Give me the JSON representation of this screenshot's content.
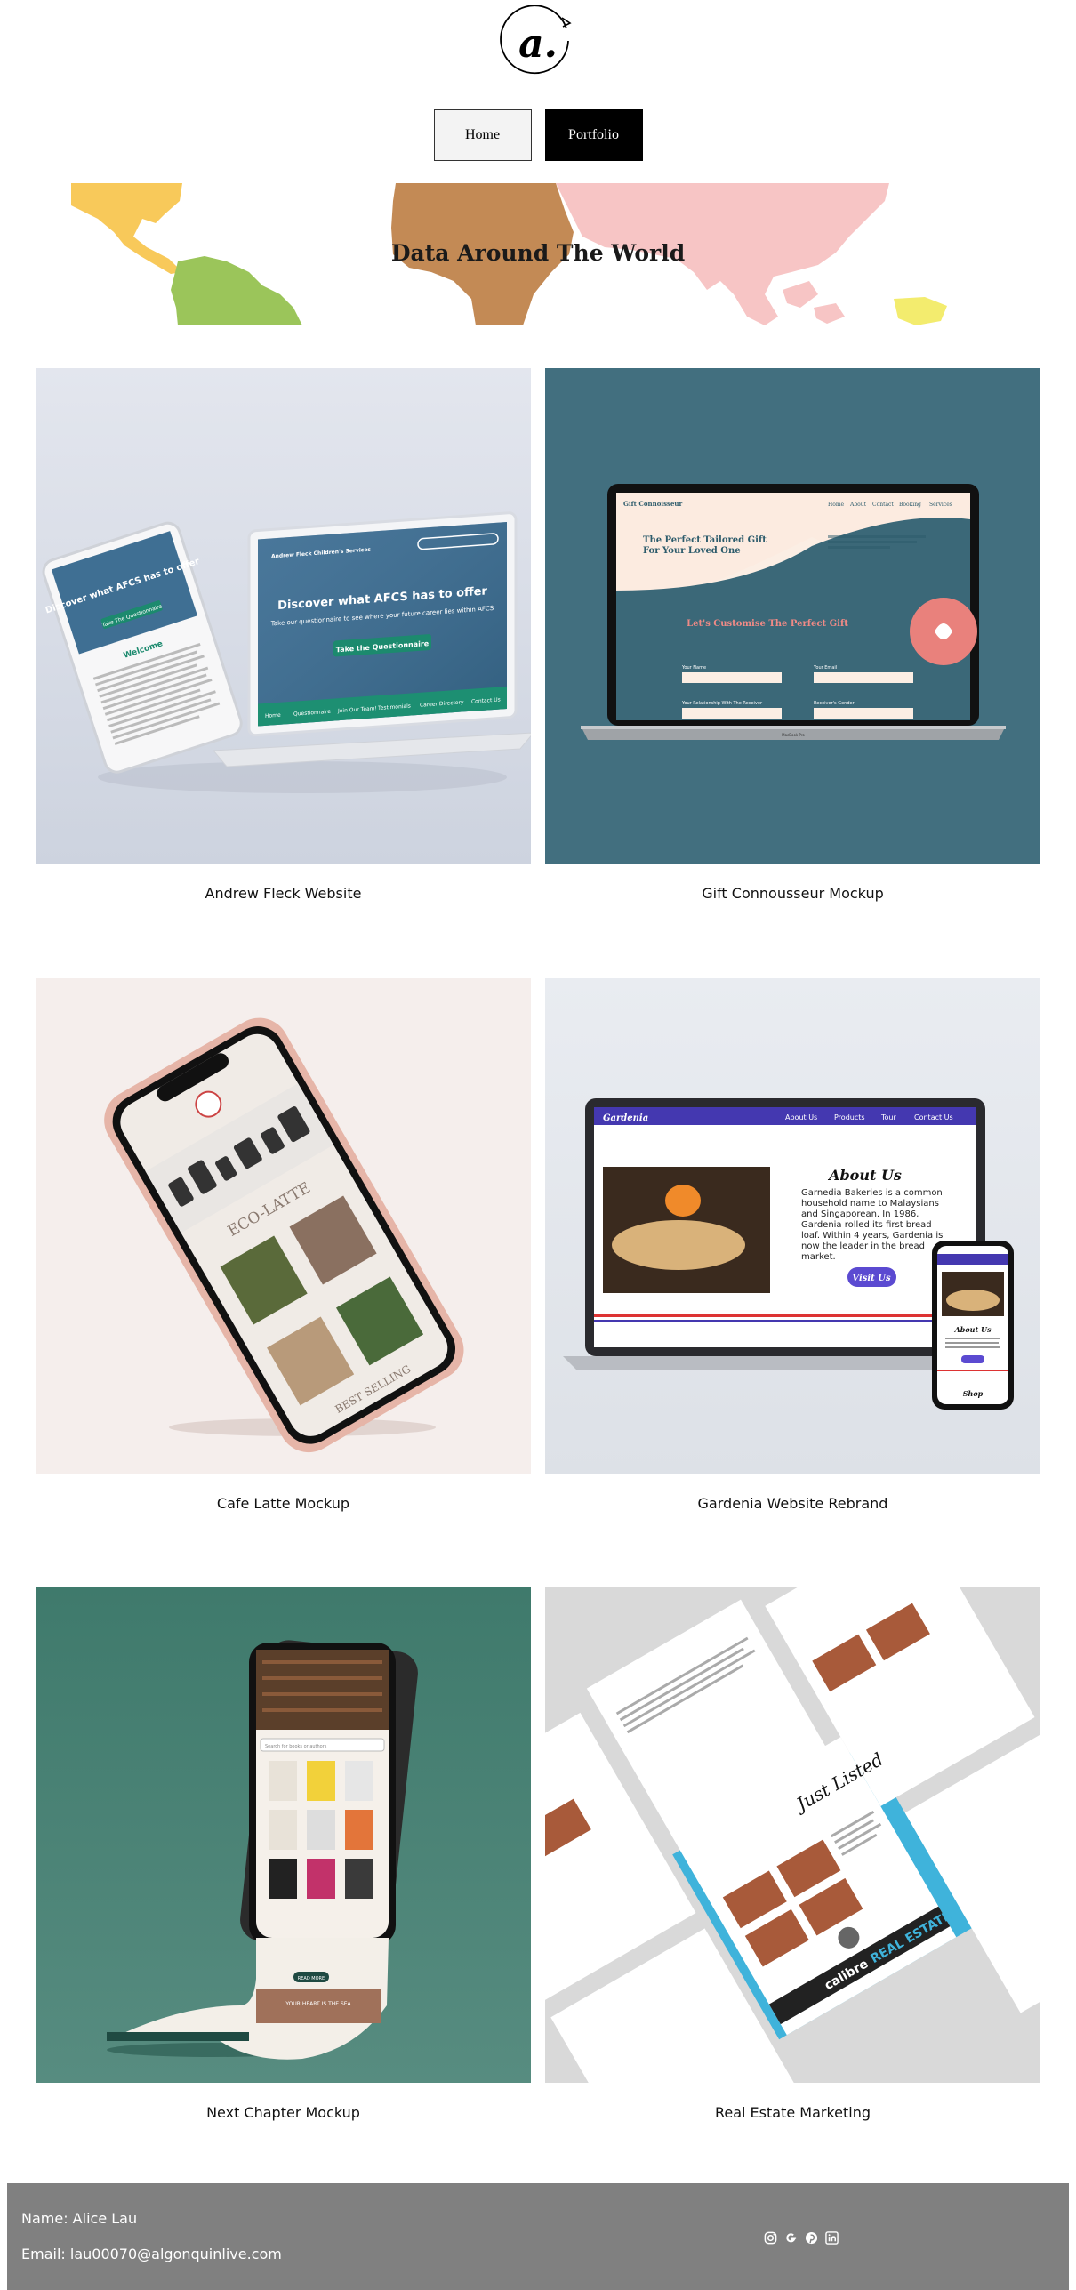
{
  "logo": {
    "letter": "a."
  },
  "nav": {
    "items": [
      {
        "label": "Home"
      },
      {
        "label": "Portfolio"
      }
    ]
  },
  "banner": {
    "title": "Data Around The World"
  },
  "projects": [
    {
      "title": "Andrew Fleck Website",
      "mock": {
        "heading": "Discover what AFCS has to offer",
        "sub": "Take our questionnaire to see where your future career lies within AFCS",
        "cta": "Take the Questionnaire",
        "brand": "Andrew Fleck Children's Services",
        "tablet_heading": "Discover what AFCS has to offer",
        "tablet_cta": "Take The Questionnaire",
        "tablet_welcome": "Welcome",
        "nav": [
          "Home",
          "Questionnaire",
          "Join Our Team!",
          "Testimonials",
          "Career Directory",
          "Contact Us"
        ]
      }
    },
    {
      "title": "Gift Connousseur Mockup",
      "mock": {
        "brand": "Gift Connoisseur",
        "nav": [
          "Home",
          "About",
          "Contact",
          "Booking",
          "Services"
        ],
        "headline": "The Perfect Tailored Gift For Your Loved One",
        "section": "Let's Customise The Perfect Gift",
        "fields": [
          "Your Name",
          "Your Email",
          "Your Relationship With The Receiver",
          "Receiver's Gender"
        ],
        "laptop_label": "MacBook Pro"
      }
    },
    {
      "title": "Cafe Latte Mockup",
      "mock": {
        "brand": "ECO-LATTE",
        "footer": "BEST SELLING"
      }
    },
    {
      "title": "Gardenia Website Rebrand",
      "mock": {
        "brand": "Gardenia",
        "nav": [
          "About Us",
          "Products",
          "Tour",
          "Contact Us"
        ],
        "heading": "About Us",
        "body": "Garnedia Bakeries is a common household name to Malaysians and Singaporean. In 1986, Gardenia rolled its first bread loaf. Within 4 years, Gardenia is now the leader in the bread market.",
        "cta": "Visit Us",
        "phone_heading": "About Us",
        "phone_shop": "Shop"
      }
    },
    {
      "title": "Next Chapter Mockup",
      "mock": {
        "search": "Search for books or authors",
        "cta": "READ MORE",
        "tagline": "YOUR HEART IS THE SEA"
      }
    },
    {
      "title": "Real Estate Marketing",
      "mock": {
        "script": "Just Listed",
        "brand_a": "calibre",
        "brand_b": "REAL ESTATE"
      }
    }
  ],
  "footer": {
    "name": "Name: Alice Lau",
    "email": "Email: lau00070@algonquinlive.com",
    "socials": [
      {
        "icon": "instagram-icon"
      },
      {
        "icon": "google-icon"
      },
      {
        "icon": "pinterest-icon"
      },
      {
        "icon": "linkedin-icon"
      }
    ]
  },
  "colors": {
    "teal": "#426f7f",
    "green": "#3a7466",
    "pink": "#f5eeec",
    "footer": "#808080"
  }
}
